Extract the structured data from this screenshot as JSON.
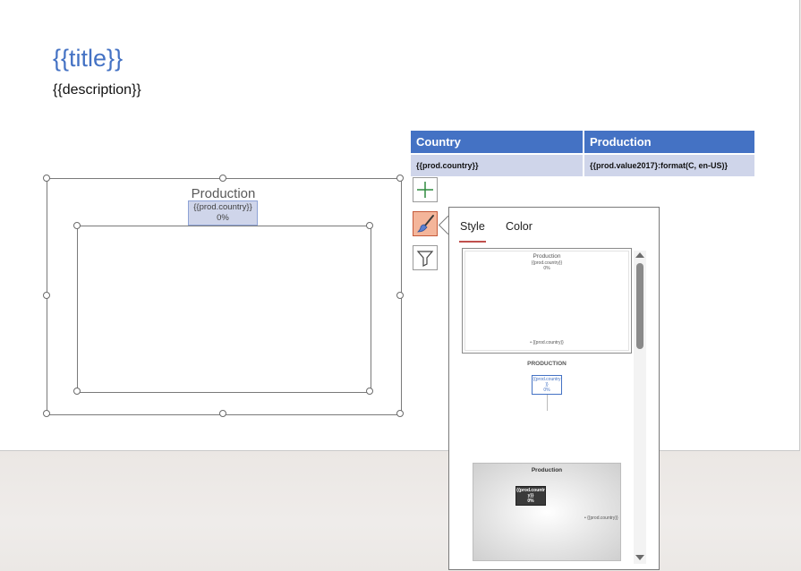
{
  "slide": {
    "title": "{{title}}",
    "description": "{{description}}"
  },
  "table": {
    "headers": [
      "Country",
      "Production"
    ],
    "row": [
      "{{prod.country}}",
      "{{prod.value2017}:format(C, en-US)}"
    ]
  },
  "chart": {
    "title": "Production",
    "data_label_line1": "{{prod.country}}",
    "data_label_line2": "0%"
  },
  "side_buttons": {
    "add": "plus-icon",
    "style": "paintbrush-icon",
    "filter": "funnel-icon"
  },
  "style_panel": {
    "tabs": [
      "Style",
      "Color"
    ],
    "active_tab": "Style",
    "thumb1": {
      "title": "Production",
      "label": "{{prod.country}}",
      "pct": "0%",
      "legend": "• {{prod.country}}"
    },
    "thumb2": {
      "title": "PRODUCTION",
      "label_a": "{{prod.country",
      "label_b": "}}",
      "pct": "0%"
    },
    "thumb3": {
      "title": "Production",
      "label_a": "{{prod.countr",
      "label_b": "y}}",
      "pct": "0%",
      "legend": "• {{prod.country}}"
    }
  },
  "colors": {
    "accent": "#4472c4",
    "table_row": "#cfd5ea",
    "active_button": "#f4b59a",
    "tab_underline": "#c0504d"
  }
}
